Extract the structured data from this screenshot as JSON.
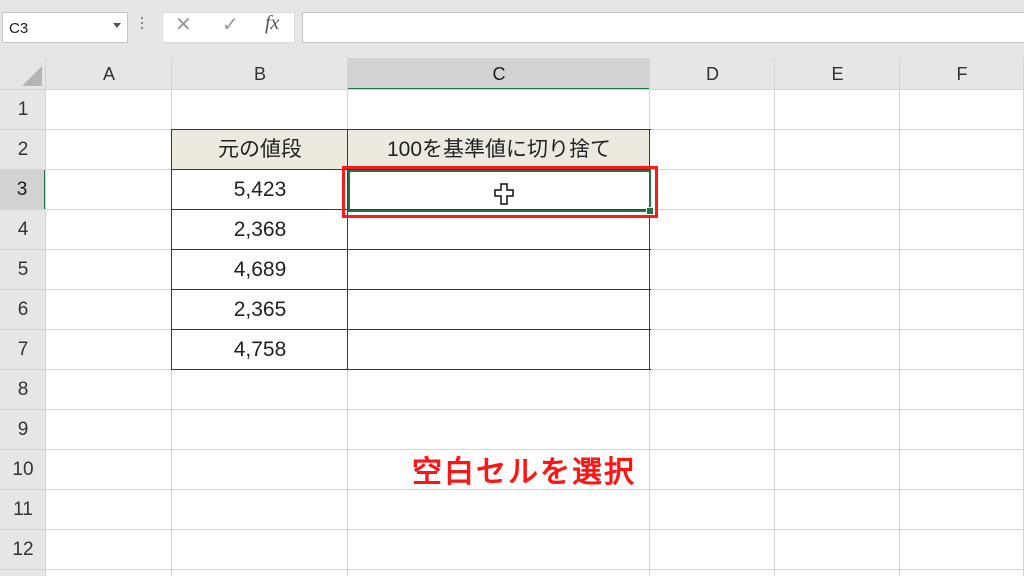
{
  "formula_bar": {
    "name_box": "C3",
    "cancel_icon": "✕",
    "enter_icon": "✓",
    "fx_label": "fx",
    "formula": ""
  },
  "columns": [
    "A",
    "B",
    "C",
    "D",
    "E",
    "F"
  ],
  "rows": [
    "1",
    "2",
    "3",
    "4",
    "5",
    "6",
    "7",
    "8",
    "9",
    "10",
    "11",
    "12"
  ],
  "table": {
    "header_b": "元の値段",
    "header_c": "100を基準値に切り捨て",
    "values": [
      "5,423",
      "2,368",
      "4,689",
      "2,365",
      "4,758"
    ]
  },
  "selection": {
    "active_cell": "C3",
    "column": "C",
    "row": "3"
  },
  "annotation": {
    "text": "空白セルを選択",
    "color": "#ff1414"
  },
  "colors": {
    "accent": "#217346",
    "header_fill": "#eceadf",
    "highlight_box": "#ff1a1a"
  }
}
